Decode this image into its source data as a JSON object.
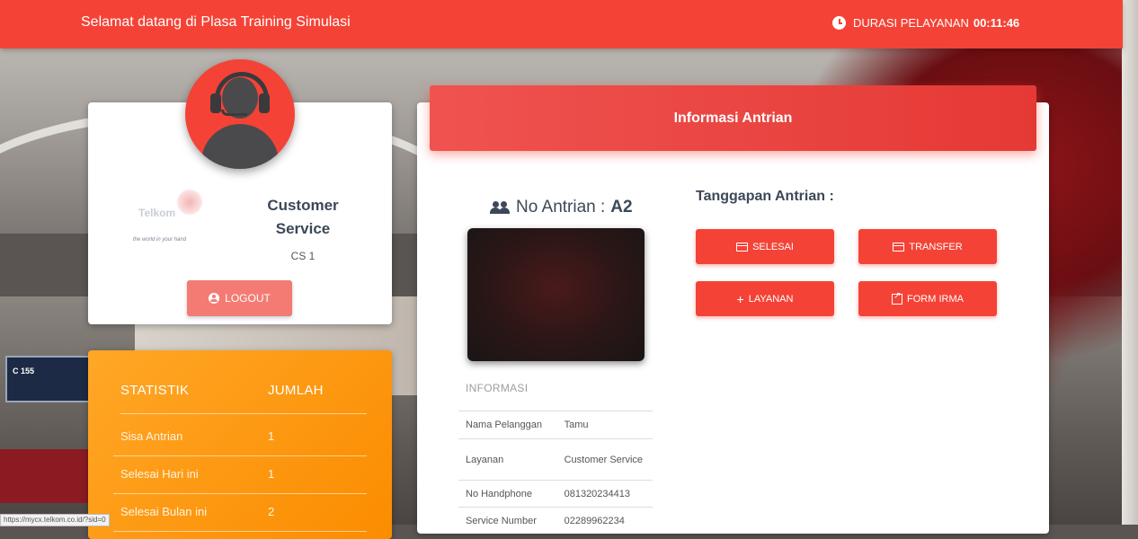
{
  "topbar": {
    "welcome": "Selamat datang di Plasa Training Simulasi",
    "durasi_label": "DURASI PELAYANAN",
    "durasi_value": "00:11:46"
  },
  "profile": {
    "logo_tagline": "the world in your hand",
    "role": "Customer Service",
    "cs_id": "CS 1",
    "logout_label": "LOGOUT"
  },
  "stats": {
    "header_left": "STATISTIK",
    "header_right": "JUMLAH",
    "rows": [
      {
        "label": "Sisa Antrian",
        "value": "1"
      },
      {
        "label": "Selesai Hari ini",
        "value": "1"
      },
      {
        "label": "Selesai Bulan ini",
        "value": "2"
      }
    ]
  },
  "main": {
    "title": "Informasi Antrian",
    "no_antrian_label": "No Antrian :",
    "no_antrian_value": "A2",
    "info_title": "INFORMASI",
    "info": [
      {
        "label": "Nama Pelanggan",
        "value": "Tamu"
      },
      {
        "label": "Layanan",
        "value": "Customer Service"
      },
      {
        "label": "No Handphone",
        "value": "081320234413"
      },
      {
        "label": "Service Number",
        "value": "02289962234"
      }
    ],
    "tanggapan_title": "Tanggapan Antrian :",
    "buttons": {
      "selesai": "SELESAI",
      "transfer": "TRANSFER",
      "layanan": "LAYANAN",
      "form_irma": "FORM IRMA"
    }
  },
  "statusbar": {
    "url": "https://mycx.telkom.co.id/?sid=0"
  },
  "colors": {
    "primary": "#f44336",
    "stats": "#fb8c00"
  }
}
